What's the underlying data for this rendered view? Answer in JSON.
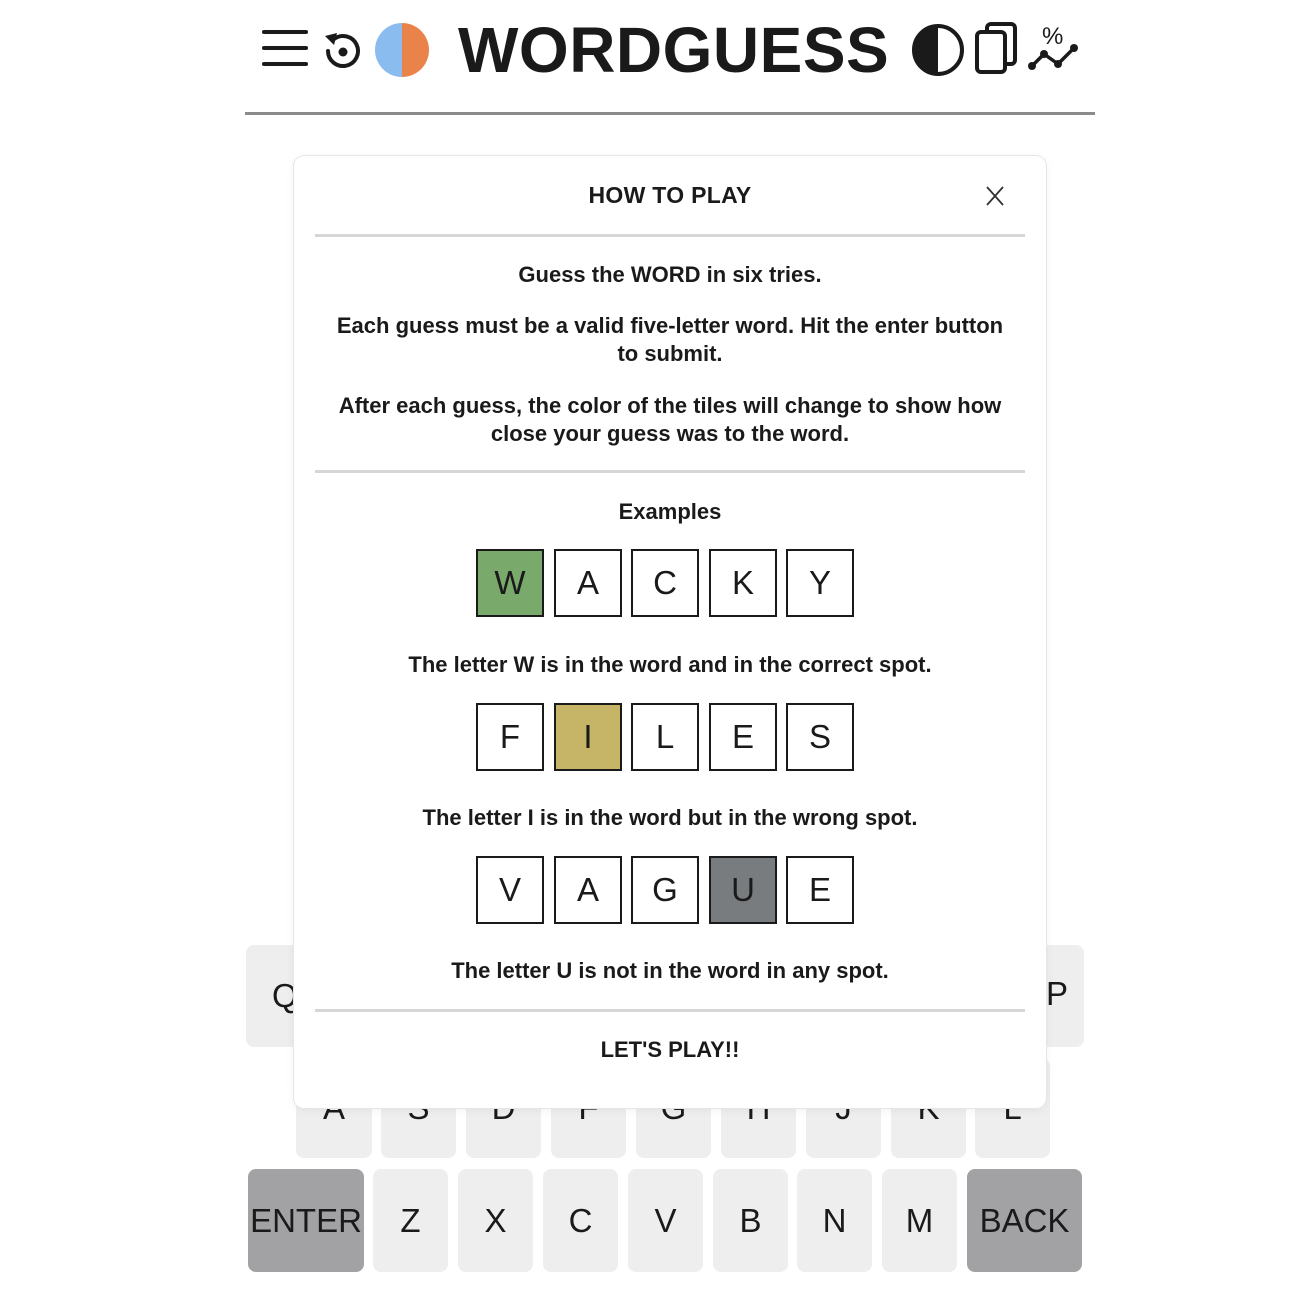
{
  "header": {
    "title": "WORDGUESS",
    "icons": {
      "menu": "menu-icon",
      "restart": "restart-icon",
      "split_circle": "color-mode-icon",
      "contrast": "contrast-icon",
      "cards": "cards-icon",
      "stats": "stats-icon"
    },
    "colors": {
      "split_left": "#8bbcf0",
      "split_right": "#e9834a"
    }
  },
  "modal": {
    "title": "HOW TO PLAY",
    "close_glyph": "X",
    "paragraphs": [
      "Guess the WORD in six tries.",
      "Each guess must be a valid five-letter word. Hit the enter button to submit.",
      "After each guess, the color of the tiles will change to show how close your guess was to the word."
    ],
    "examples_title": "Examples",
    "examples": [
      {
        "letters": [
          "W",
          "A",
          "C",
          "K",
          "Y"
        ],
        "highlight_index": 0,
        "state": "correct",
        "caption": "The letter W is in the word and in the correct spot."
      },
      {
        "letters": [
          "F",
          "I",
          "L",
          "E",
          "S"
        ],
        "highlight_index": 1,
        "state": "present",
        "caption": "The letter I is in the word but in the wrong spot."
      },
      {
        "letters": [
          "V",
          "A",
          "G",
          "U",
          "E"
        ],
        "highlight_index": 3,
        "state": "absent",
        "caption": "The letter U is not in the word in any spot."
      }
    ],
    "play_button": "LET'S PLAY!!",
    "colors": {
      "correct": "#79a96b",
      "present": "#c6b566",
      "absent": "#787c7e"
    }
  },
  "keyboard": {
    "row1": [
      "Q",
      "P"
    ],
    "row2": [
      "A",
      "S",
      "D",
      "F",
      "G",
      "H",
      "J",
      "K",
      "L"
    ],
    "row3": [
      "ENTER",
      "Z",
      "X",
      "C",
      "V",
      "B",
      "N",
      "M",
      "BACK"
    ]
  }
}
